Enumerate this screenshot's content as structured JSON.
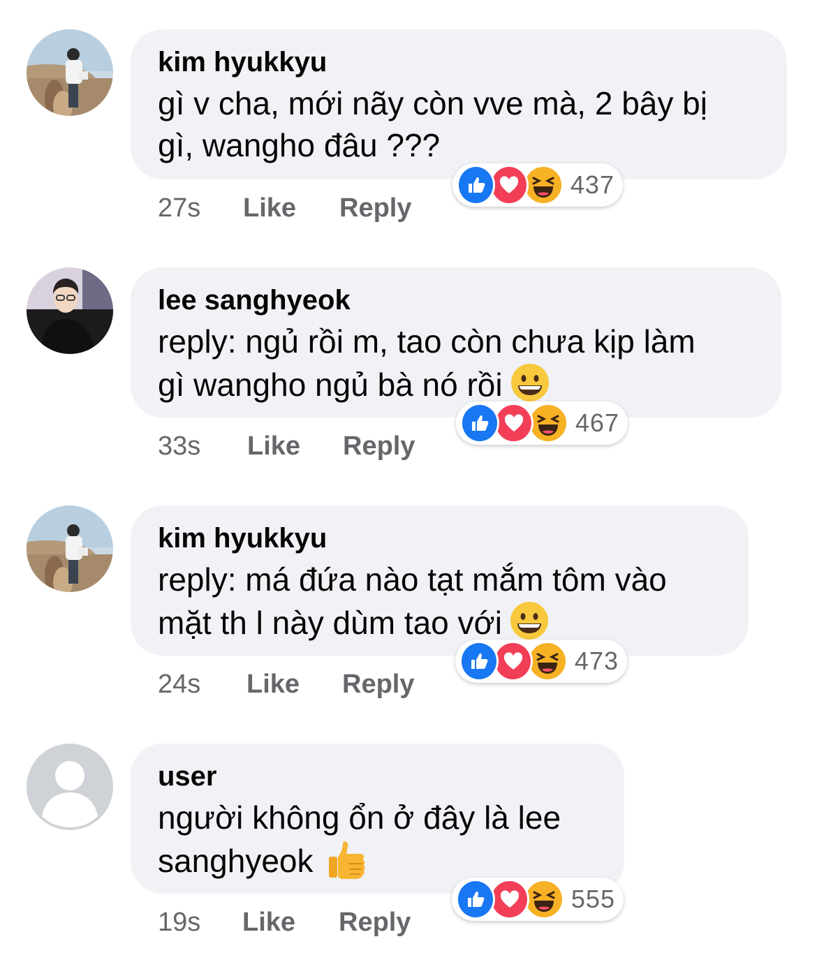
{
  "colors": {
    "bubble_bg": "#f0f2f5",
    "meta_text": "#65676b",
    "like_blue": "#1877f2",
    "love_red": "#f33e58",
    "haha_yellow": "#f7b125"
  },
  "comments": [
    {
      "author": "kim hyukkyu",
      "avatar": "photo-avatar-alpaca",
      "lines": [
        "gì v cha, mới nãy còn vve mà, 2 bây bị",
        "gì, wangho đâu ???"
      ],
      "trailing_emoji": "",
      "time": "27s",
      "like_label": "Like",
      "reply_label": "Reply",
      "reaction_icons": [
        "like-icon",
        "love-icon",
        "haha-icon"
      ],
      "reaction_count": "437"
    },
    {
      "author": "lee sanghyeok",
      "avatar": "photo-avatar-portrait",
      "lines": [
        "reply: ngủ rồi m, tao còn chưa kịp làm",
        "gì wangho ngủ bà nó rồi"
      ],
      "trailing_emoji": "grinning-face-emoji",
      "time": "33s",
      "like_label": "Like",
      "reply_label": "Reply",
      "reaction_icons": [
        "like-icon",
        "love-icon",
        "haha-icon"
      ],
      "reaction_count": "467"
    },
    {
      "author": "kim hyukkyu",
      "avatar": "photo-avatar-alpaca",
      "lines": [
        "reply: má đứa nào tạt mắm tôm vào",
        "mặt th l này dùm tao với"
      ],
      "trailing_emoji": "grinning-face-emoji",
      "time": "24s",
      "like_label": "Like",
      "reply_label": "Reply",
      "reaction_icons": [
        "like-icon",
        "love-icon",
        "haha-icon"
      ],
      "reaction_count": "473"
    },
    {
      "author": "user",
      "avatar": "default-avatar",
      "lines": [
        "người không ổn ở đây là lee",
        "sanghyeok"
      ],
      "trailing_emoji": "thumbs-up-emoji",
      "time": "19s",
      "like_label": "Like",
      "reply_label": "Reply",
      "reaction_icons": [
        "like-icon",
        "love-icon",
        "haha-icon"
      ],
      "reaction_count": "555"
    }
  ]
}
